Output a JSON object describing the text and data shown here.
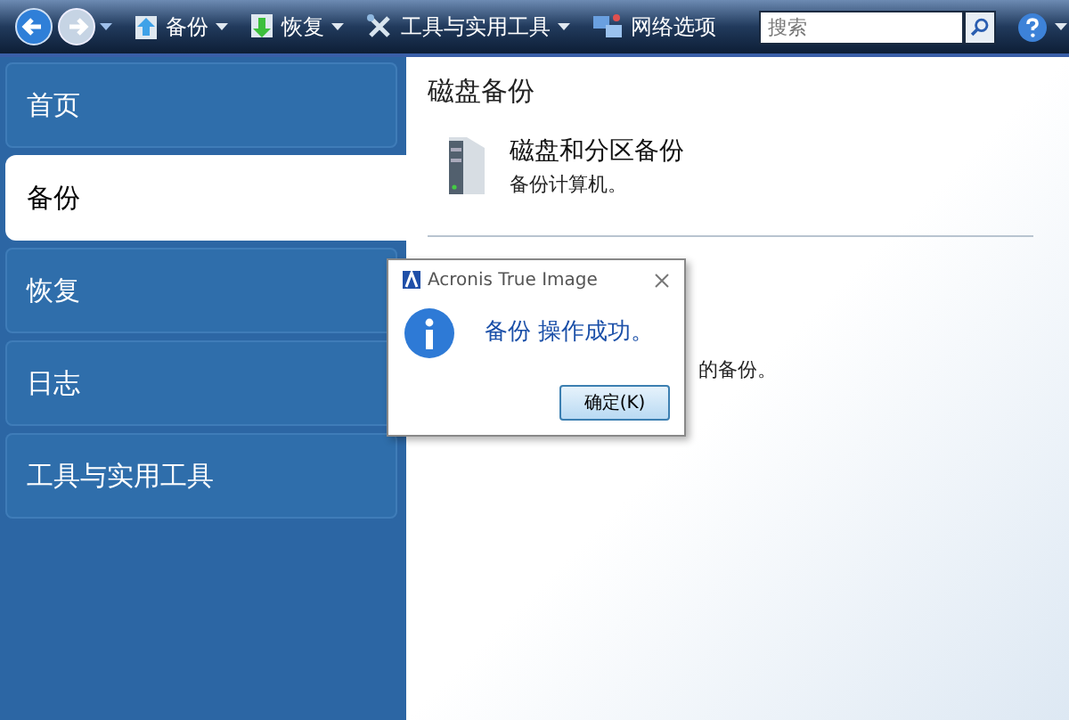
{
  "toolbar": {
    "items": [
      {
        "label": "备份",
        "dropdown": true,
        "kind": "backup"
      },
      {
        "label": "恢复",
        "dropdown": true,
        "kind": "restore"
      },
      {
        "label": "工具与实用工具",
        "dropdown": true,
        "kind": "tools"
      },
      {
        "label": "网络选项",
        "dropdown": false,
        "kind": "network"
      }
    ],
    "search": {
      "placeholder": "搜索"
    }
  },
  "sidebar": {
    "items": [
      {
        "label": "首页",
        "selected": false
      },
      {
        "label": "备份",
        "selected": true
      },
      {
        "label": "恢复",
        "selected": false
      },
      {
        "label": "日志",
        "selected": false
      },
      {
        "label": "工具与实用工具",
        "selected": false
      }
    ]
  },
  "main": {
    "title": "磁盘备份",
    "action": {
      "title": "磁盘和分区备份",
      "description": "备份计算机。"
    },
    "partial_text": "的备份。"
  },
  "dialog": {
    "title": "Acronis True Image",
    "message": "备份 操作成功。",
    "button": "确定(K)"
  }
}
